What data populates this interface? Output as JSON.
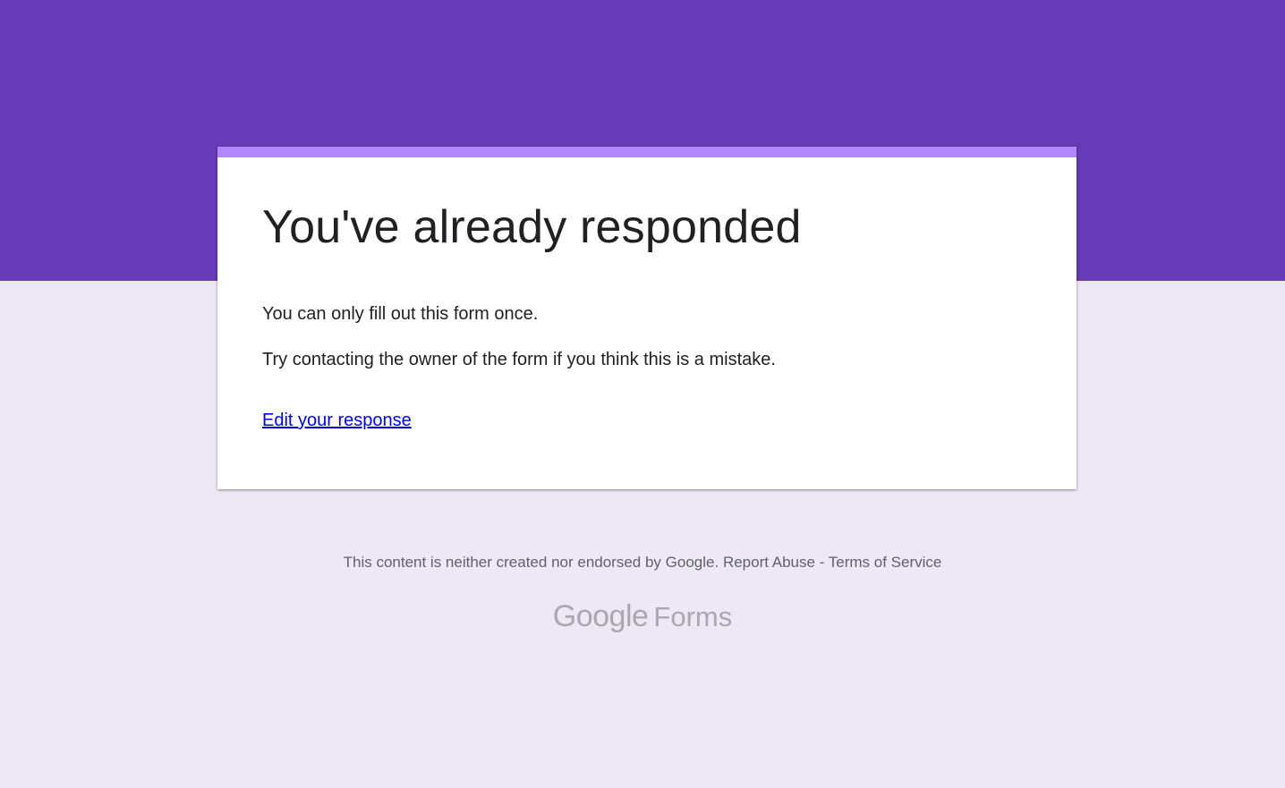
{
  "card": {
    "title": "You've already responded",
    "message_1": "You can only fill out this form once.",
    "message_2": "Try contacting the owner of the form if you think this is a mistake.",
    "edit_link_label": "Edit your response"
  },
  "footer": {
    "disclaimer": "This content is neither created nor endorsed by Google.",
    "report_abuse_label": "Report Abuse",
    "separator": "-",
    "terms_label": "Terms of Service"
  },
  "logo": {
    "google": "Google",
    "forms": "Forms"
  },
  "colors": {
    "header_band": "#673ab7",
    "card_accent": "#b388ff",
    "page_background": "#ede7f6",
    "link": "#0000ee"
  }
}
